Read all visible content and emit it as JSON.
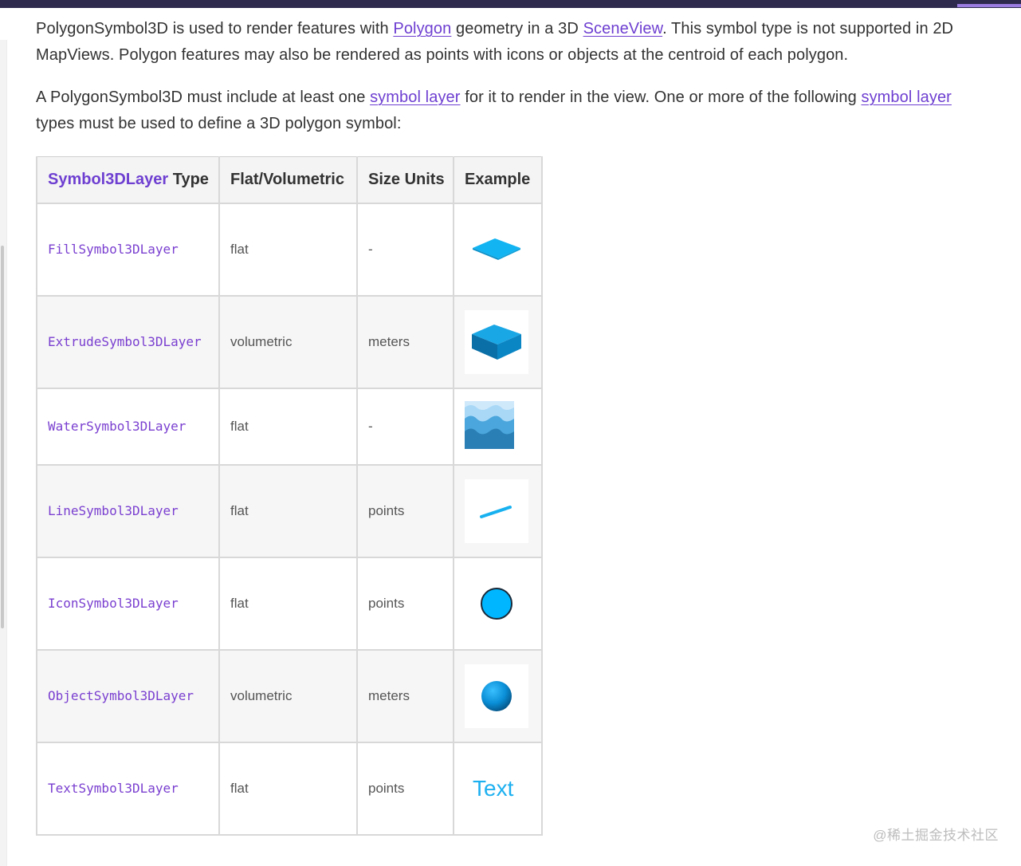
{
  "intro": {
    "p1_a": "PolygonSymbol3D is used to render features with ",
    "p1_link1": "Polygon",
    "p1_b": " geometry in a 3D ",
    "p1_link2": "SceneView",
    "p1_c": ". This symbol type is not supported in 2D MapViews. Polygon features may also be rendered as points with icons or objects at the centroid of each polygon.",
    "p2_a": "A PolygonSymbol3D must include at least one ",
    "p2_link1": "symbol layer",
    "p2_b": " for it to render in the view. One or more of the following ",
    "p2_link2": "symbol layer",
    "p2_c": " types must be used to define a 3D polygon symbol:"
  },
  "table": {
    "headers": {
      "type_highlight": "Symbol3DLayer",
      "type_rest": " Type",
      "flat": "Flat/Volumetric",
      "size": "Size Units",
      "example": "Example"
    },
    "rows": [
      {
        "type": "FillSymbol3DLayer",
        "flat": "flat",
        "size": "-",
        "example_icon": "fill-diamond-icon"
      },
      {
        "type": "ExtrudeSymbol3DLayer",
        "flat": "volumetric",
        "size": "meters",
        "example_icon": "extrude-cube-icon"
      },
      {
        "type": "WaterSymbol3DLayer",
        "flat": "flat",
        "size": "-",
        "example_icon": "water-waves-icon"
      },
      {
        "type": "LineSymbol3DLayer",
        "flat": "flat",
        "size": "points",
        "example_icon": "line-segment-icon"
      },
      {
        "type": "IconSymbol3DLayer",
        "flat": "flat",
        "size": "points",
        "example_icon": "circle-icon"
      },
      {
        "type": "ObjectSymbol3DLayer",
        "flat": "volumetric",
        "size": "meters",
        "example_icon": "sphere-icon"
      },
      {
        "type": "TextSymbol3DLayer",
        "flat": "flat",
        "size": "points",
        "example_text": "Text"
      }
    ]
  },
  "watermark": "@稀土掘金技术社区",
  "colors": {
    "link": "#6e3fd1",
    "code": "#7a3fd0",
    "symbol_blue": "#1db0f0",
    "topbar": "#2d2a4e"
  }
}
